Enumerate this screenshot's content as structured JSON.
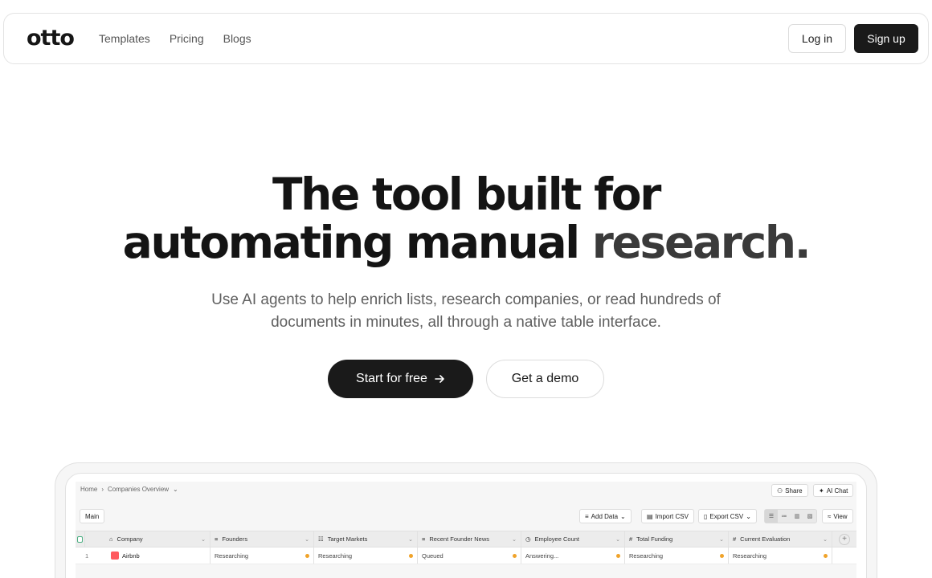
{
  "nav": {
    "logo": "otto",
    "links": [
      "Templates",
      "Pricing",
      "Blogs"
    ],
    "login_label": "Log in",
    "signup_label": "Sign up"
  },
  "hero": {
    "title_line1": "The tool built for",
    "title_line2_a": "automating manual ",
    "title_line2_b": "research.",
    "subtitle": "Use AI agents to help enrich lists, research companies, or read hundreds of documents in minutes, all through a native table interface.",
    "start_label": "Start for free",
    "demo_label": "Get a demo"
  },
  "app": {
    "breadcrumb": {
      "home": "Home",
      "separator": "›",
      "current": "Companies Overview"
    },
    "share_label": "Share",
    "ai_chat_label": "AI Chat",
    "tab_main": "Main",
    "toolbar": {
      "add_data": "Add Data",
      "import_csv": "Import CSV",
      "export_csv": "Export CSV",
      "view": "View"
    },
    "columns": [
      "Company",
      "Founders",
      "Target Markets",
      "Recent Founder News",
      "Employee Count",
      "Total Funding",
      "Current Evaluation"
    ],
    "rows": [
      {
        "index": "1",
        "company": "Airbnb",
        "cells": [
          "Researching",
          "Researching",
          "Queued",
          "Answering...",
          "Researching",
          "Researching"
        ]
      }
    ]
  },
  "colors": {
    "primary": "#1a1a1a",
    "status_dot": "#f0a32a",
    "airbnb": "#ff5a5f"
  }
}
